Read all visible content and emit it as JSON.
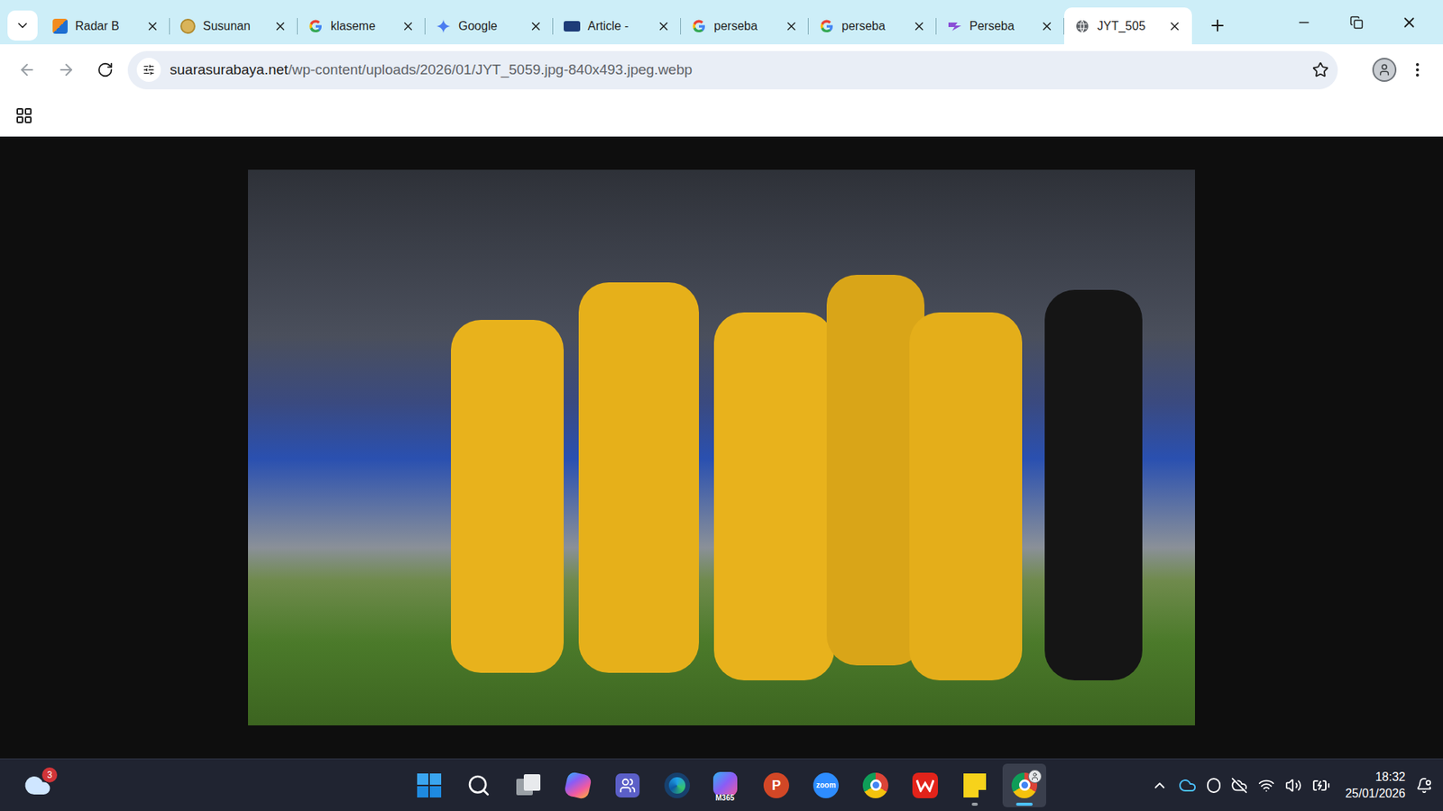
{
  "tabs": [
    {
      "label": "Radar B",
      "kind": "radar",
      "selected": false
    },
    {
      "label": "Susunan",
      "kind": "tempo",
      "selected": false
    },
    {
      "label": "klaseme",
      "kind": "google",
      "selected": false
    },
    {
      "label": "Google",
      "kind": "gemini",
      "selected": false
    },
    {
      "label": "Article -",
      "kind": "ro",
      "selected": false
    },
    {
      "label": "perseba",
      "kind": "google",
      "selected": false
    },
    {
      "label": "perseba",
      "kind": "google",
      "selected": false
    },
    {
      "label": "Perseba",
      "kind": "perseba",
      "selected": false
    },
    {
      "label": "JYT_505",
      "kind": "globe",
      "selected": true
    }
  ],
  "address_bar": {
    "host": "suarasurabaya.net",
    "path": "/wp-content/uploads/2026/01/JYT_5059.jpg-840x493.jpeg.webp",
    "bookmarked": false
  },
  "taskbar": {
    "weather_badge": "3",
    "apps": [
      {
        "kind": "start",
        "label": "",
        "running": false,
        "active": false
      },
      {
        "kind": "search",
        "label": "",
        "running": false,
        "active": false
      },
      {
        "kind": "taskview",
        "label": "",
        "running": false,
        "active": false
      },
      {
        "kind": "copilot",
        "label": "",
        "running": false,
        "active": false
      },
      {
        "kind": "teams",
        "label": "",
        "running": false,
        "active": false
      },
      {
        "kind": "edge",
        "label": "",
        "running": false,
        "active": false
      },
      {
        "kind": "m365",
        "label": "M365",
        "running": false,
        "active": false
      },
      {
        "kind": "powerpoint",
        "label": "P",
        "running": false,
        "active": false
      },
      {
        "kind": "zoom",
        "label": "zoom",
        "running": false,
        "active": false
      },
      {
        "kind": "chrome",
        "label": "",
        "running": false,
        "active": false
      },
      {
        "kind": "wps",
        "label": "",
        "running": false,
        "active": false
      },
      {
        "kind": "sticky",
        "label": "",
        "running": true,
        "active": false
      },
      {
        "kind": "chrome-profile",
        "label": "",
        "running": true,
        "active": true
      }
    ],
    "time": "18:32",
    "date": "25/01/2026"
  }
}
